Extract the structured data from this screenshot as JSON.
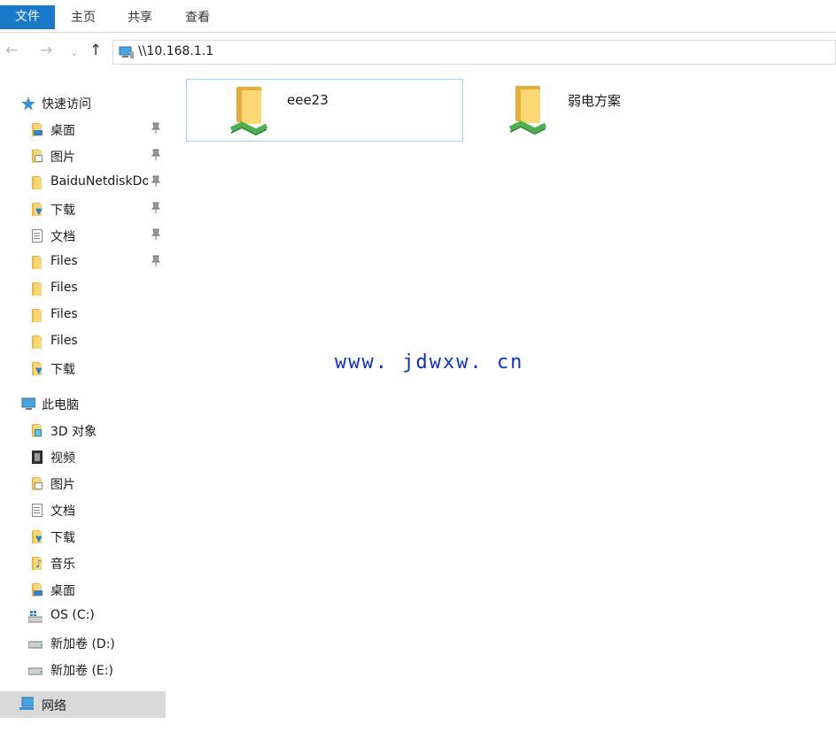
{
  "ribbon": {
    "tabs": [
      "文件",
      "主页",
      "共享",
      "查看"
    ]
  },
  "address": {
    "path": "\\\\10.168.1.1"
  },
  "sidebar": {
    "quick_access": "快速访问",
    "quick_items": [
      "桌面",
      "图片",
      "BaiduNetdiskDownload",
      "下载",
      "文档",
      "Files",
      "Files",
      "Files",
      "Files",
      "下载"
    ],
    "this_pc": "此电脑",
    "pc_items": [
      "3D 对象",
      "视频",
      "图片",
      "文档",
      "下载",
      "音乐",
      "桌面",
      "OS (C:)",
      "新加卷 (D:)",
      "新加卷 (E:)"
    ],
    "network": "网络"
  },
  "content": {
    "folders": [
      "eee23",
      "弱电方案"
    ]
  },
  "watermark": "www. jdwxw. cn",
  "colors": {
    "file_tab": "#1979ca",
    "selection_border": "#99d1ff",
    "watermark": "#0c2fd6"
  }
}
